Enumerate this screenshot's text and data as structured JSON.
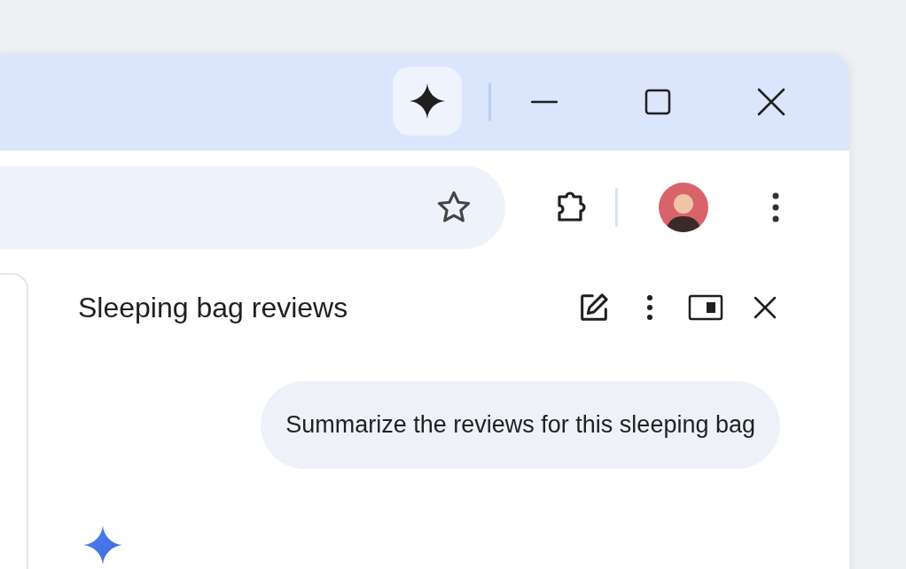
{
  "side_panel": {
    "title": "Sleeping bag reviews",
    "messages": [
      {
        "kind": "bubble",
        "text": "Summarize the reviews for this sleeping bag"
      },
      {
        "kind": "sparkle"
      }
    ]
  }
}
